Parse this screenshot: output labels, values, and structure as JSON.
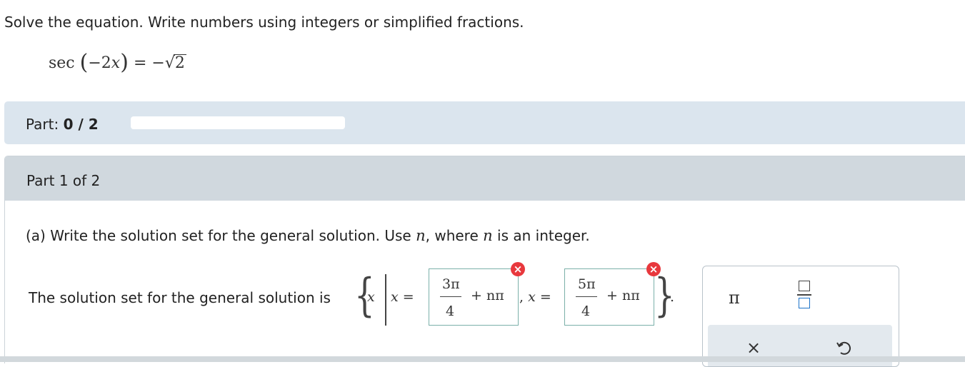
{
  "instruction": "Solve the equation. Write numbers using integers or simplified fractions.",
  "equation": {
    "func": "sec",
    "arg_coef": "−2",
    "arg_var": "x",
    "rhs_sign": "−",
    "radicand": "2"
  },
  "progress": {
    "label": "Part:",
    "value": "0 / 2",
    "fraction": 0
  },
  "part1": {
    "title": "Part 1 of 2"
  },
  "question": {
    "prefix": "(a) Write the solution set for the general solution. Use",
    "var": "n",
    "mid": ", where",
    "var2": "n",
    "suffix": "is an integer."
  },
  "answer": {
    "label": "The solution set for the general solution is",
    "set_var": "x",
    "eq1": "x =",
    "sep": ", x =",
    "period": ".",
    "box1": {
      "num": "3π",
      "den": "4",
      "term": "+ nπ",
      "status": "incorrect"
    },
    "box2": {
      "num": "5π",
      "den": "4",
      "term": "+ nπ",
      "status": "incorrect"
    }
  },
  "toolbox": {
    "pi": "π",
    "clear": "×",
    "icons": [
      "pi-icon",
      "fraction-icon",
      "clear-icon",
      "undo-icon"
    ]
  },
  "colors": {
    "error": "#e8383d",
    "box_border": "#7bb0a9",
    "accent": "#1d73c9"
  }
}
